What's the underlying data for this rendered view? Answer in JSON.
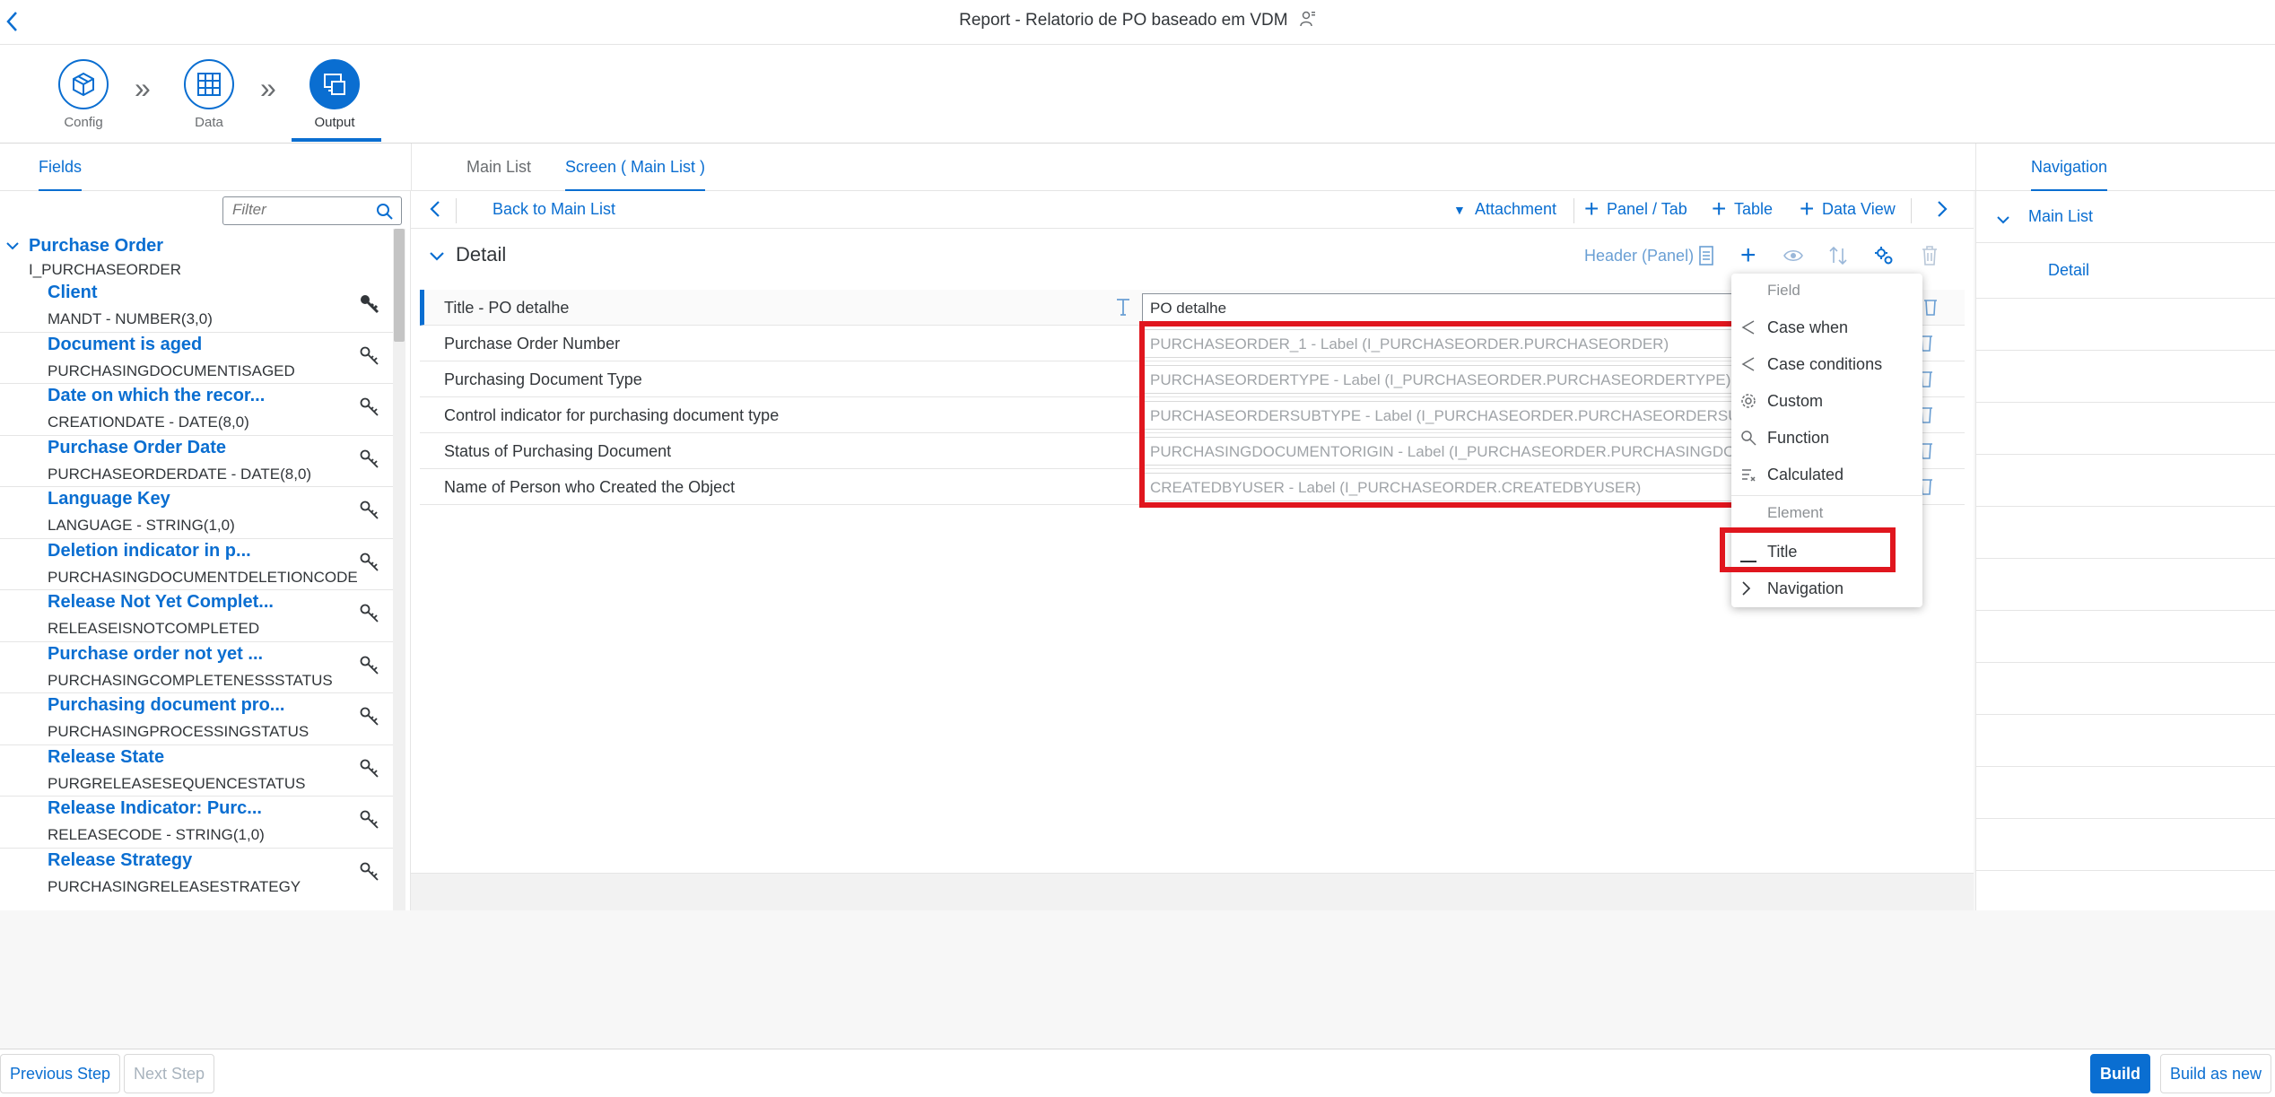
{
  "app": {
    "title": "Report - Relatorio de PO baseado em VDM"
  },
  "wizard": {
    "steps": [
      {
        "label": "Config"
      },
      {
        "label": "Data"
      },
      {
        "label": "Output"
      }
    ]
  },
  "tabs": {
    "left": "Fields",
    "center": [
      "Main List",
      "Screen ( Main List )"
    ],
    "right": "Navigation"
  },
  "fields_panel": {
    "filter_placeholder": "Filter",
    "root": {
      "name": "Purchase Order",
      "tech": "I_PURCHASEORDER"
    },
    "items": [
      {
        "name": "Client",
        "tech": "MANDT - NUMBER(3,0)"
      },
      {
        "name": "Document is aged",
        "tech": "PURCHASINGDOCUMENTISAGED"
      },
      {
        "name": "Date on which the recor...",
        "tech": "CREATIONDATE - DATE(8,0)"
      },
      {
        "name": "Purchase Order Date",
        "tech": "PURCHASEORDERDATE - DATE(8,0)"
      },
      {
        "name": "Language Key",
        "tech": "LANGUAGE - STRING(1,0)"
      },
      {
        "name": "Deletion indicator in p...",
        "tech": "PURCHASINGDOCUMENTDELETIONCODE"
      },
      {
        "name": "Release Not Yet Complet...",
        "tech": "RELEASEISNOTCOMPLETED"
      },
      {
        "name": "Purchase order not yet ...",
        "tech": "PURCHASINGCOMPLETENESSSTATUS"
      },
      {
        "name": "Purchasing document pro...",
        "tech": "PURCHASINGPROCESSINGSTATUS"
      },
      {
        "name": "Release State",
        "tech": "PURGRELEASESEQUENCESTATUS"
      },
      {
        "name": "Release Indicator: Purc...",
        "tech": "RELEASECODE - STRING(1,0)"
      },
      {
        "name": "Release Strategy",
        "tech": "PURCHASINGRELEASESTRATEGY"
      }
    ]
  },
  "toolbar": {
    "back_label": "Back to Main List",
    "attachment": "Attachment",
    "panel_tab": "Panel / Tab",
    "table": "Table",
    "data_view": "Data View"
  },
  "detail": {
    "title": "Detail",
    "header_panel": "Header (Panel)",
    "rows": [
      {
        "label": "Title - PO detalhe",
        "value": "PO detalhe"
      },
      {
        "label": "Purchase Order Number",
        "value": "PURCHASEORDER_1 - Label (I_PURCHASEORDER.PURCHASEORDER)"
      },
      {
        "label": "Purchasing Document Type",
        "value": "PURCHASEORDERTYPE - Label (I_PURCHASEORDER.PURCHASEORDERTYPE)"
      },
      {
        "label": "Control indicator for purchasing document type",
        "value": "PURCHASEORDERSUBTYPE - Label (I_PURCHASEORDER.PURCHASEORDERSUBTYPE)"
      },
      {
        "label": "Status of Purchasing Document",
        "value": "PURCHASINGDOCUMENTORIGIN - Label (I_PURCHASEORDER.PURCHASINGDOCUMENTORIGIN)"
      },
      {
        "label": "Name of Person who Created the Object",
        "value": "CREATEDBYUSER - Label (I_PURCHASEORDER.CREATEDBYUSER)"
      }
    ]
  },
  "dropdown": {
    "group_field": "Field",
    "field_items": [
      "Case when",
      "Case conditions",
      "Custom",
      "Function",
      "Calculated"
    ],
    "group_element": "Element",
    "element_items": [
      "Title",
      "Navigation"
    ]
  },
  "navigation_panel": {
    "items": [
      "Main List",
      "Detail"
    ]
  },
  "footer": {
    "previous": "Previous Step",
    "next": "Next Step",
    "build": "Build",
    "build_as_new": "Build as new"
  },
  "colors": {
    "accent": "#0a6ed1",
    "highlight": "#e0161e"
  }
}
